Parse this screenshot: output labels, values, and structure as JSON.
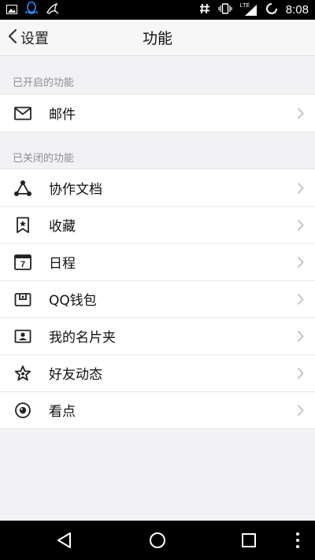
{
  "status_bar": {
    "time": "8:08",
    "left_icons": [
      "image-icon",
      "qq-icon",
      "bird-icon"
    ],
    "right_icons": [
      "hash-icon",
      "vibrate-icon",
      "lte-signal-icon",
      "battery-icon"
    ],
    "lte_text": "LTE"
  },
  "header": {
    "back_label": "设置",
    "title": "功能"
  },
  "sections": {
    "enabled": {
      "label": "已开启的功能",
      "items": [
        {
          "label": "邮件",
          "icon": "mail-icon"
        }
      ]
    },
    "disabled": {
      "label": "已关闭的功能",
      "items": [
        {
          "label": "协作文档",
          "icon": "collab-doc-icon"
        },
        {
          "label": "收藏",
          "icon": "favorites-icon"
        },
        {
          "label": "日程",
          "icon": "calendar-icon"
        },
        {
          "label": "QQ钱包",
          "icon": "wallet-icon"
        },
        {
          "label": "我的名片夹",
          "icon": "card-holder-icon"
        },
        {
          "label": "好友动态",
          "icon": "star-icon"
        },
        {
          "label": "看点",
          "icon": "eye-icon"
        }
      ]
    }
  },
  "calendar_day": "7",
  "bottom_nav": [
    "back-triangle-icon",
    "home-circle-icon",
    "recents-square-icon",
    "more-dots-icon"
  ]
}
